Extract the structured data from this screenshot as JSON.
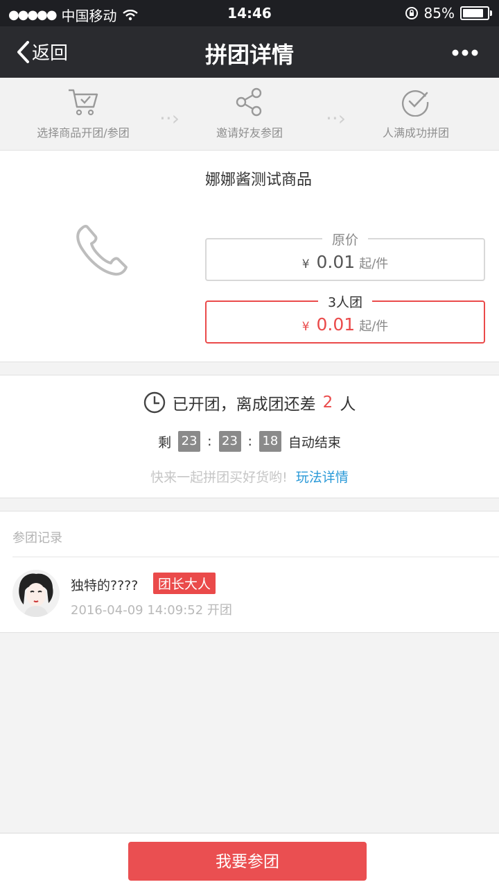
{
  "status_bar": {
    "carrier": "中国移动",
    "time": "14:46",
    "battery": "85%",
    "battery_level": 0.85
  },
  "nav": {
    "back_label": "返回",
    "title": "拼团详情"
  },
  "steps": [
    {
      "label": "选择商品开团/参团",
      "icon": "cart-icon"
    },
    {
      "label": "邀请好友参团",
      "icon": "share-icon"
    },
    {
      "label": "人满成功拼团",
      "icon": "check-circle-icon"
    }
  ],
  "product": {
    "name": "娜娜酱测试商品",
    "original": {
      "tag": "原价",
      "currency": "¥",
      "amount": "0.01",
      "unit": "起/件"
    },
    "group": {
      "tag": "3人团",
      "currency": "¥",
      "amount": "0.01",
      "unit": "起/件"
    }
  },
  "group_status": {
    "prefix": "已开团，离成团还差",
    "count": "2",
    "suffix": "人",
    "remain_label": "剩",
    "hours": "23",
    "minutes": "23",
    "seconds": "18",
    "sep": ":",
    "end_label": "自动结束",
    "tip": "快来一起拼团买好货哟!",
    "rules_link": "玩法详情"
  },
  "records": {
    "title": "参团记录",
    "items": [
      {
        "name": "独特的????",
        "badge": "团长大人",
        "meta": "2016-04-09 14:09:52 开团"
      }
    ]
  },
  "bottom": {
    "join_label": "我要参团"
  },
  "colors": {
    "accent": "#ea4a4a",
    "link": "#2b9ad8",
    "nav_bg": "#2a2b2f"
  }
}
